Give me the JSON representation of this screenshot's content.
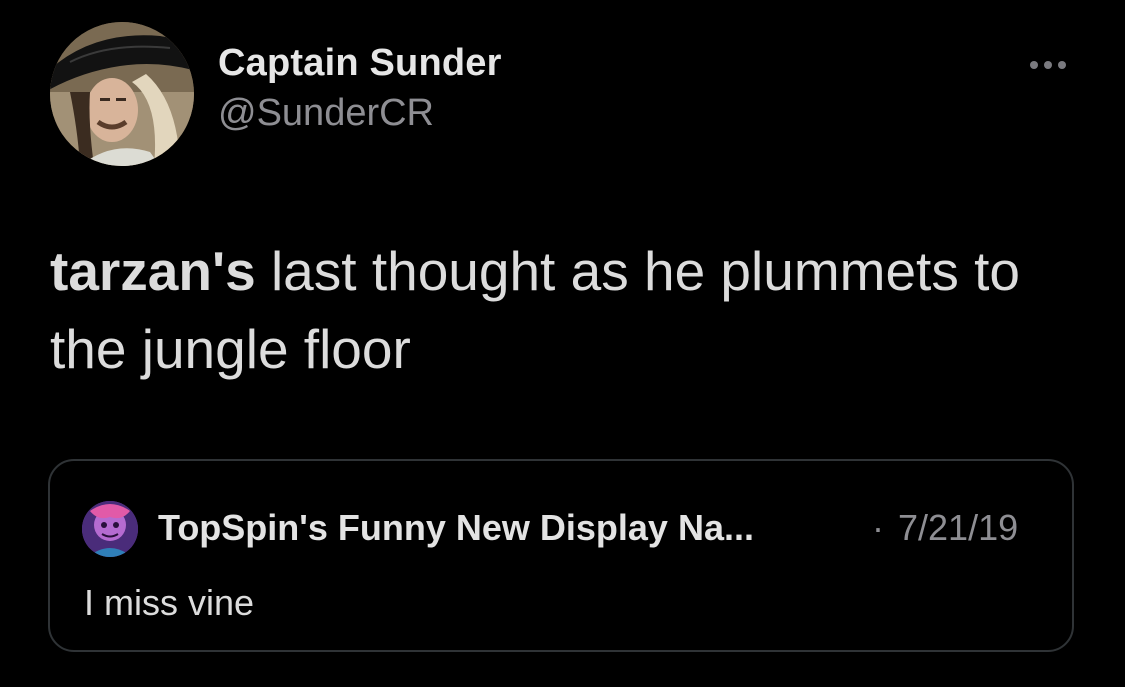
{
  "tweet": {
    "author_name": "Captain Sunder",
    "author_handle": "@SunderCR",
    "more_icon": "more-horizontal-icon",
    "text_bold": "tarzan's",
    "text_rest": " last thought as he plummets to the jungle floor"
  },
  "quoted_tweet": {
    "author_name": "TopSpin's Funny New Display Na...",
    "separator": "·",
    "date": "7/21/19",
    "text": "I miss vine"
  },
  "colors": {
    "background": "#000000",
    "primary_text": "#dcdcdc",
    "secondary_text": "#8e8e93",
    "border": "#2f3336"
  }
}
